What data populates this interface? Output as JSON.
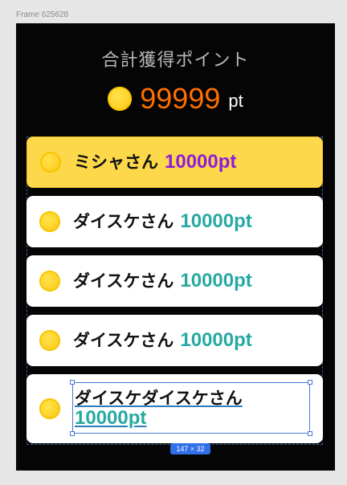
{
  "editor": {
    "frame_label": "Frame 625628",
    "selection_size": "147 × 32"
  },
  "summary": {
    "title": "合計獲得ポイント",
    "total_value": "99999",
    "unit": "pt"
  },
  "cards": [
    {
      "name": "ミシャさん",
      "points": "10000pt",
      "state": "active"
    },
    {
      "name": "ダイスケさん",
      "points": "10000pt",
      "state": "normal"
    },
    {
      "name": "ダイスケさん",
      "points": "10000pt",
      "state": "normal"
    },
    {
      "name": "ダイスケさん",
      "points": "10000pt",
      "state": "normal"
    },
    {
      "name": "ダイスケダイスケさん",
      "points": "10000pt",
      "state": "selected"
    }
  ],
  "colors": {
    "frame_background": "#050505",
    "accent_total": "#ff6f00",
    "active_card": "#fdd84a",
    "active_points": "#8d1ed8",
    "normal_points": "#27a9a3",
    "selection": "#4e78d9",
    "badge": "#2f6fe8"
  },
  "icons": {
    "coin": "coin-icon"
  }
}
